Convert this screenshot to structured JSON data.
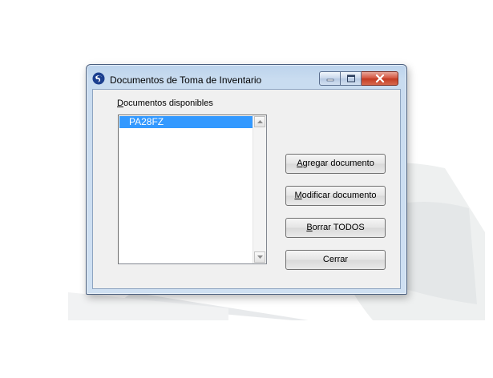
{
  "window": {
    "title": "Documentos de Toma de Inventario"
  },
  "list": {
    "label_first": "D",
    "label_rest": "ocumentos disponibles",
    "items": [
      "PA28FZ"
    ],
    "selected_index": 0
  },
  "buttons": {
    "add_first": "A",
    "add_rest": "gregar documento",
    "modify_first": "M",
    "modify_rest": "odificar documento",
    "delete_first": "B",
    "delete_rest": "orrar TODOS",
    "close": "Cerrar"
  },
  "icons": {
    "app": "app-logo-icon",
    "minimize": "minimize-icon",
    "maximize": "maximize-icon",
    "close": "close-icon",
    "scroll_up": "scroll-up-arrow-icon",
    "scroll_down": "scroll-down-arrow-icon"
  },
  "colors": {
    "selection": "#3399ff",
    "close_button": "#c13a22",
    "titlebar": "#bcd3ec"
  }
}
